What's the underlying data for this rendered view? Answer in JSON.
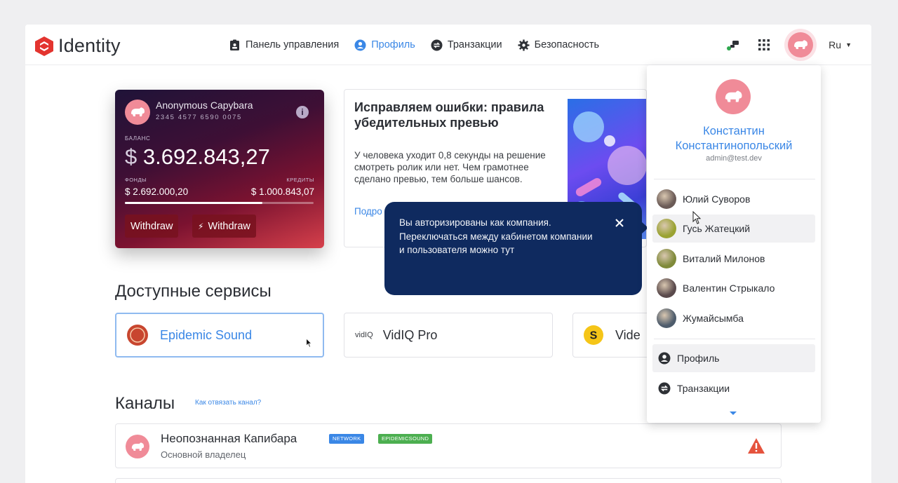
{
  "app": {
    "name": "Identity"
  },
  "nav": [
    {
      "label": "Панель управления",
      "icon": "dashboard-icon",
      "active": false
    },
    {
      "label": "Профиль",
      "icon": "profile-icon",
      "active": true
    },
    {
      "label": "Транзакции",
      "icon": "transactions-icon",
      "active": false
    },
    {
      "label": "Безопасность",
      "icon": "gear-icon",
      "active": false
    }
  ],
  "header": {
    "language": "Ru"
  },
  "card": {
    "name": "Anonymous Capybara",
    "number": "2345  4577  6590  0075",
    "balance_label": "БАЛАНС",
    "currency": "$",
    "balance": "3.692.843,27",
    "funds_label": "ФОНДЫ",
    "funds_value": "$ 2.692.000,20",
    "credits_label": "КРЕДИТЫ",
    "credits_value": "$ 1.000.843,07",
    "funds_fraction": 0.73,
    "withdraw_label": "Withdraw",
    "withdraw2_label": "Withdraw"
  },
  "promo": {
    "title": "Исправляем ошибки: правила убедительных превью",
    "text": "У человека уходит 0,8 секунды на решение смотреть ролик или нет. Чем грамотнее сделано превью, тем больше шансов.",
    "link": "Подро"
  },
  "services": {
    "title": "Доступные сервисы",
    "items": [
      {
        "name": "Epidemic Sound",
        "selected": true
      },
      {
        "name": "VidIQ Pro",
        "logo_text": "vidIQ",
        "selected": false
      },
      {
        "name": "Vide",
        "selected": false
      }
    ]
  },
  "channels": {
    "title": "Каналы",
    "unlink_link": "Как отвязать канал?",
    "items": [
      {
        "name": "Неопознанная Капибара",
        "role": "Основной владелец",
        "tags": [
          "NETWORK",
          "EPIDEMICSOUND"
        ]
      }
    ]
  },
  "tooltip": {
    "text": "Вы авторизированы как компания. Переключаться между кабинетом компании и пользователя можно тут"
  },
  "dropdown": {
    "name": "Константин Константинопольский",
    "email": "admin@test.dev",
    "users": [
      {
        "name": "Юлий Суворов",
        "avatar_color": "#6b5b57"
      },
      {
        "name": "Гусь Жатецкий",
        "avatar_color": "#9aa232"
      },
      {
        "name": "Виталий Милонов",
        "avatar_color": "#7f8a3a"
      },
      {
        "name": "Валентин Стрыкало",
        "avatar_color": "#5a4a4c"
      },
      {
        "name": "Жумайсымба",
        "avatar_color": "#4e5c6c"
      }
    ],
    "menu": [
      {
        "label": "Профиль",
        "icon": "profile-icon"
      },
      {
        "label": "Транзакции",
        "icon": "transactions-icon"
      }
    ]
  },
  "colors": {
    "accent": "#3a87e6",
    "brand_red": "#e3342f",
    "tooltip_bg": "#0f2a5f",
    "avatar_pink": "#f08b98"
  }
}
